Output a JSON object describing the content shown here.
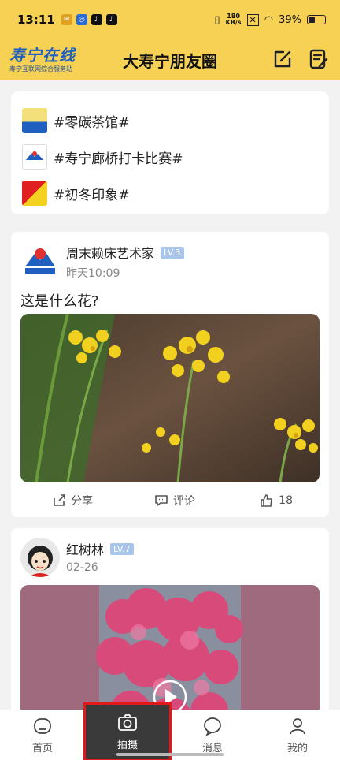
{
  "status_bar": {
    "time": "13:11",
    "speed_top": "180",
    "speed_bottom": "KB/s",
    "battery": "39%"
  },
  "header": {
    "logo_main": "寿宁在线",
    "logo_sub": "寿宁互联网综合服务站",
    "title": "大寿宁朋友圈",
    "icons": [
      "edit-icon",
      "note-icon"
    ]
  },
  "topics": [
    {
      "label": "#零碳茶馆#"
    },
    {
      "label": "#寿宁廊桥打卡比赛#"
    },
    {
      "label": "#初冬印象#"
    }
  ],
  "posts": [
    {
      "username": "周末赖床艺术家",
      "level": "LV.3",
      "time": "昨天10:09",
      "text": "这是什么花?",
      "share_label": "分享",
      "comment_label": "评论",
      "likes": "18"
    },
    {
      "username": "红树林",
      "level": "LV.7",
      "time": "02-26"
    }
  ],
  "bottom_nav": [
    {
      "label": "首页",
      "icon": "home-icon"
    },
    {
      "label": "拍摄",
      "icon": "camera-icon",
      "active": true
    },
    {
      "label": "消息",
      "icon": "message-icon"
    },
    {
      "label": "我的",
      "icon": "profile-icon"
    }
  ],
  "colors": {
    "header_bg": "#f6d154",
    "level_badge": "#a9c6ea",
    "active_nav_bg": "#3a3a3a",
    "highlight_border": "#e01a1a"
  }
}
